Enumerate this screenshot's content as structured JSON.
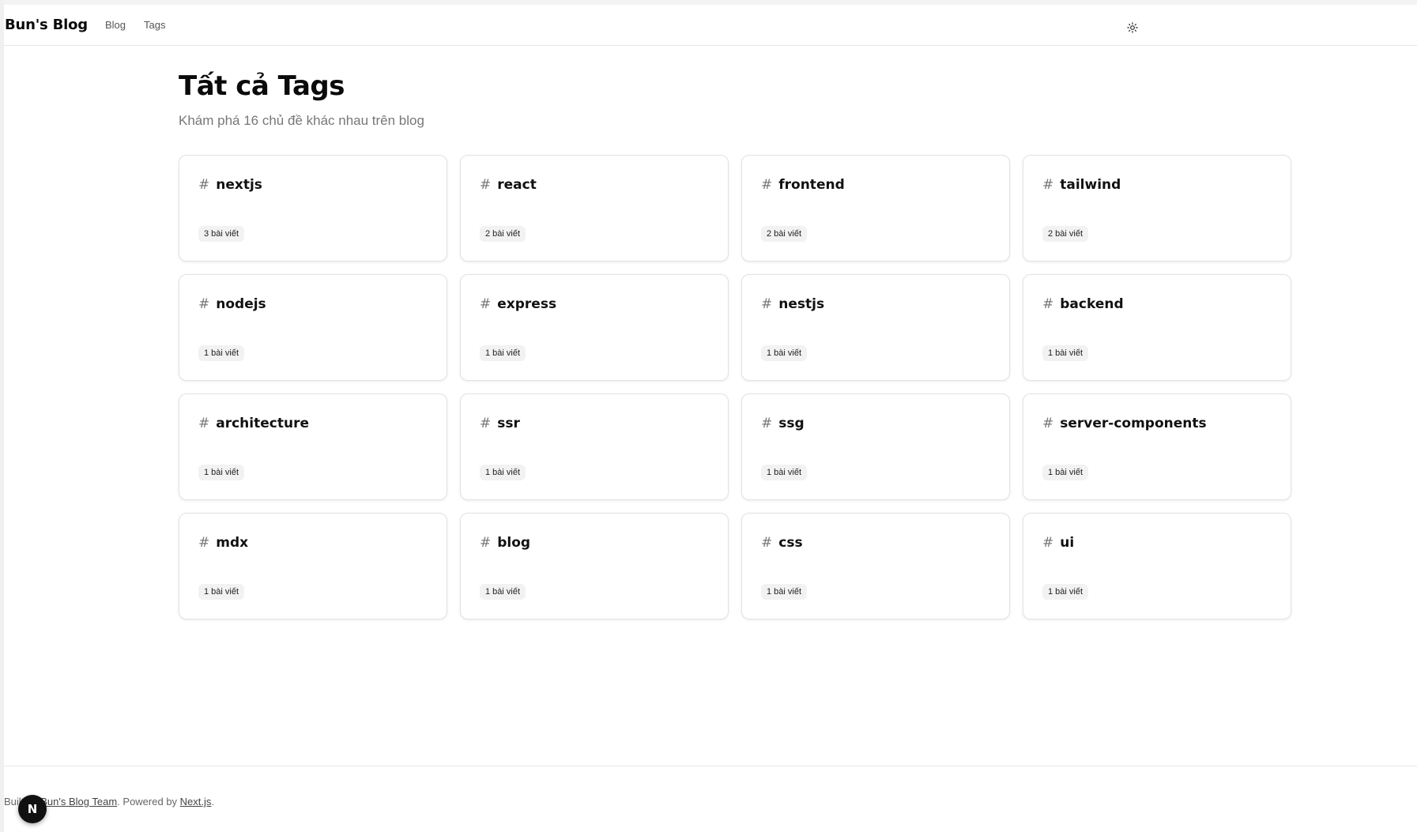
{
  "nav": {
    "brand": "Bun's Blog",
    "links": [
      "Blog",
      "Tags"
    ],
    "theme_icon": "sun-icon"
  },
  "page": {
    "title": "Tất cả Tags",
    "subtitle": "Khám phá 16 chủ đề khác nhau trên blog"
  },
  "tags": [
    {
      "name": "nextjs",
      "count": "3 bài viết"
    },
    {
      "name": "react",
      "count": "2 bài viết"
    },
    {
      "name": "frontend",
      "count": "2 bài viết"
    },
    {
      "name": "tailwind",
      "count": "2 bài viết"
    },
    {
      "name": "nodejs",
      "count": "1 bài viết"
    },
    {
      "name": "express",
      "count": "1 bài viết"
    },
    {
      "name": "nestjs",
      "count": "1 bài viết"
    },
    {
      "name": "backend",
      "count": "1 bài viết"
    },
    {
      "name": "architecture",
      "count": "1 bài viết"
    },
    {
      "name": "ssr",
      "count": "1 bài viết"
    },
    {
      "name": "ssg",
      "count": "1 bài viết"
    },
    {
      "name": "server-components",
      "count": "1 bài viết"
    },
    {
      "name": "mdx",
      "count": "1 bài viết"
    },
    {
      "name": "blog",
      "count": "1 bài viết"
    },
    {
      "name": "css",
      "count": "1 bài viết"
    },
    {
      "name": "ui",
      "count": "1 bài viết"
    }
  ],
  "footer": {
    "prefix": "Built by ",
    "author": "Bun's Blog Team",
    "middle": ". Powered by ",
    "framework": "Next.js",
    "suffix": "."
  },
  "dev_badge": "N"
}
